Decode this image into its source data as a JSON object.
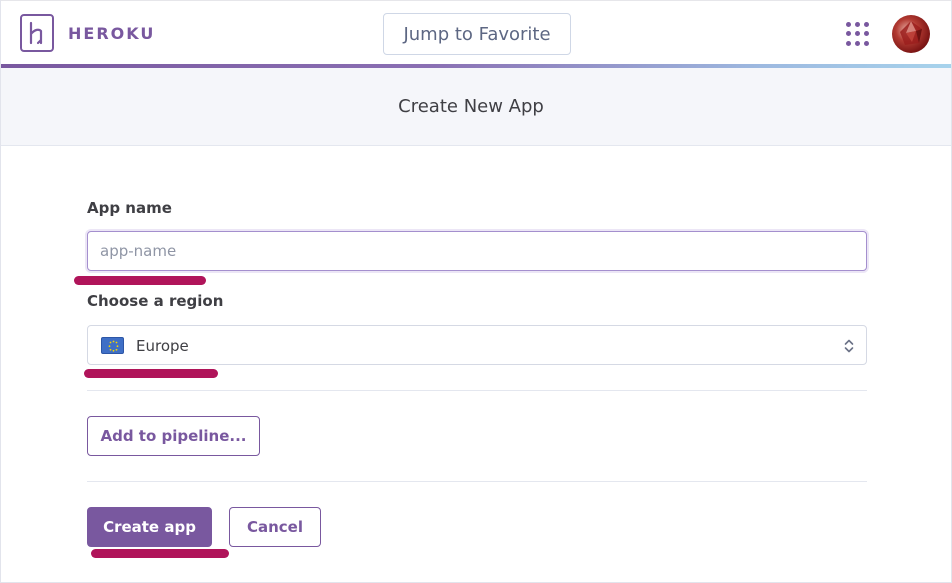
{
  "header": {
    "brand": "HEROKU",
    "jump_label": "Jump to Favorite",
    "apps_icon": "apps-grid-icon",
    "avatar_icon": "user-avatar"
  },
  "page": {
    "title": "Create New App"
  },
  "form": {
    "app_name_label": "App name",
    "app_name_value": "",
    "app_name_placeholder": "app-name",
    "region_label": "Choose a region",
    "region_value": "Europe",
    "region_icon": "eu-flag-icon",
    "pipeline_button": "Add to pipeline...",
    "create_button": "Create app",
    "cancel_button": "Cancel"
  },
  "colors": {
    "brand": "#79589f",
    "annotation": "#b0145a"
  }
}
